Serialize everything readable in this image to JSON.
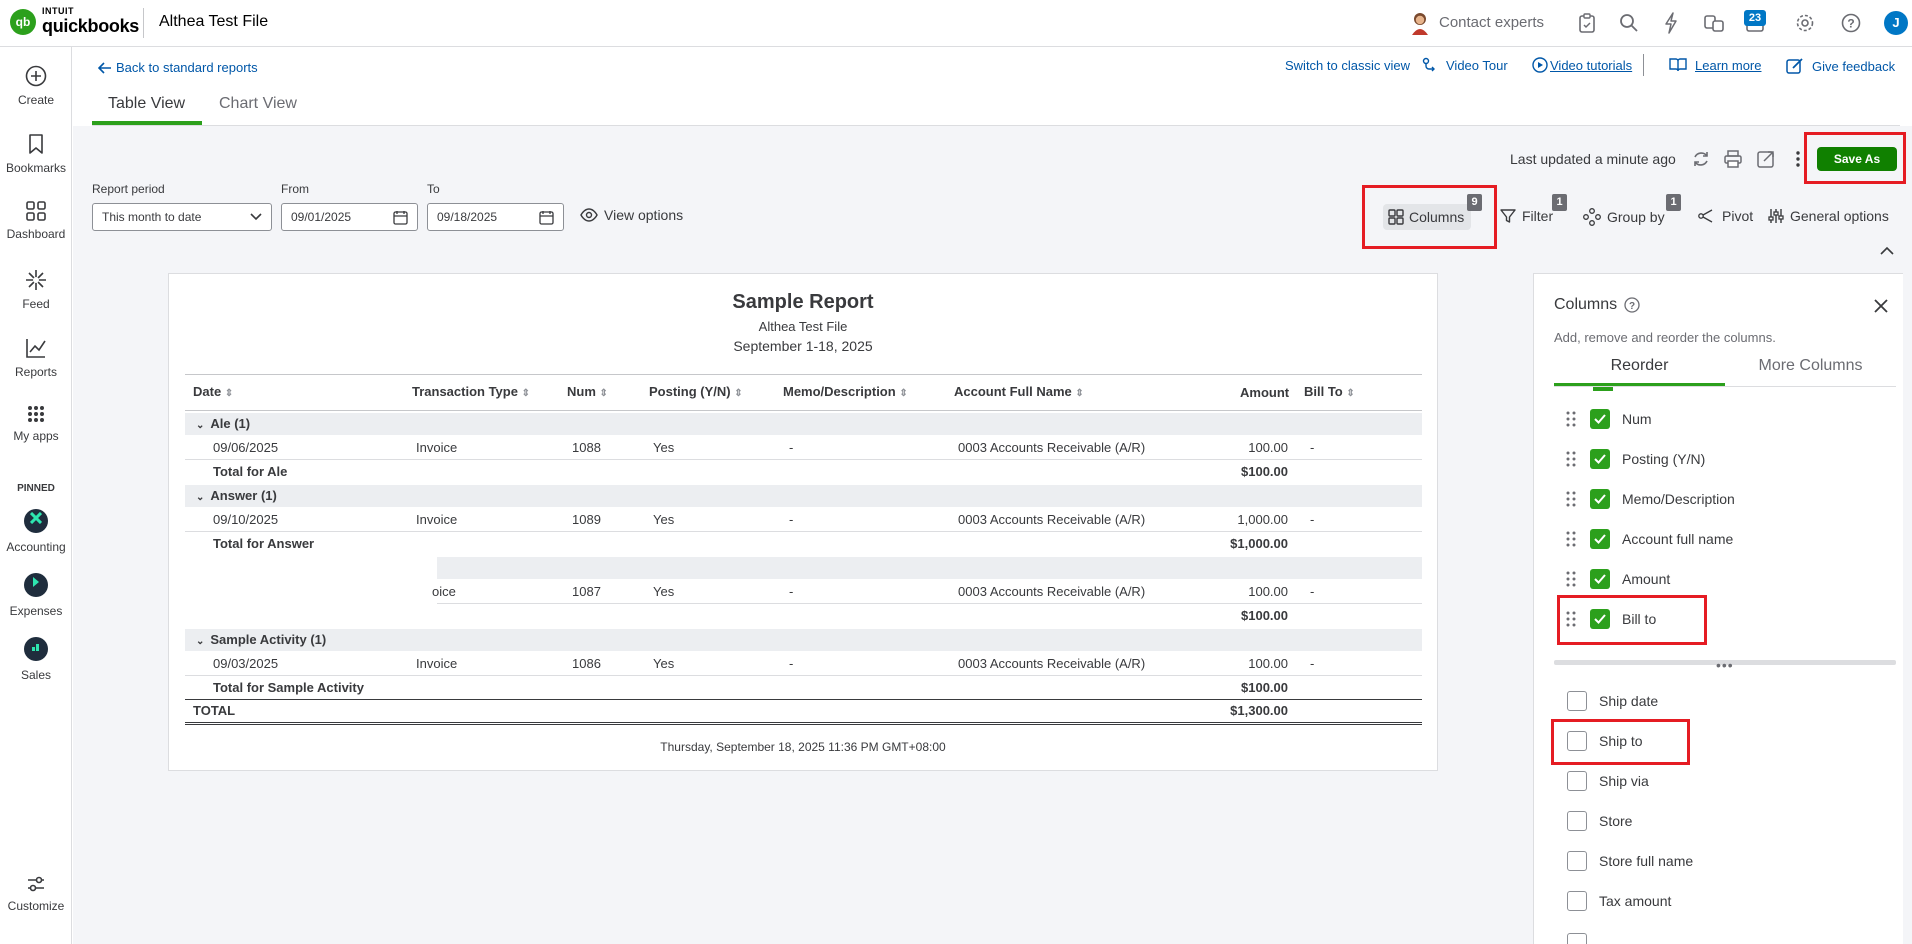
{
  "app": {
    "brand_small": "INTUIT",
    "brand": "quickbooks",
    "company": "Althea Test File"
  },
  "topbar": {
    "contact_experts": "Contact experts",
    "notification_count": "23",
    "avatar_initial": "J"
  },
  "leftnav": {
    "items": [
      {
        "label": "Create"
      },
      {
        "label": "Bookmarks"
      },
      {
        "label": "Dashboard"
      },
      {
        "label": "Feed"
      },
      {
        "label": "Reports"
      },
      {
        "label": "My apps"
      }
    ],
    "pinned_heading": "PINNED",
    "pinned": [
      {
        "label": "Accounting"
      },
      {
        "label": "Expenses"
      },
      {
        "label": "Sales"
      }
    ],
    "customize": "Customize"
  },
  "header": {
    "back_link": "Back to standard reports",
    "switch_classic": "Switch to classic view",
    "video_tour": "Video Tour",
    "video_tutorials": "Video tutorials",
    "learn_more": "Learn more",
    "give_feedback": "Give feedback",
    "tabs": [
      {
        "label": "Table View",
        "active": true
      },
      {
        "label": "Chart View",
        "active": false
      }
    ]
  },
  "toolbar": {
    "last_updated": "Last updated a minute ago",
    "save_as": "Save As",
    "report_period_label": "Report period",
    "report_period_value": "This month to date",
    "from_label": "From",
    "from_value": "09/01/2025",
    "to_label": "To",
    "to_value": "09/18/2025",
    "view_options": "View options",
    "columns": "Columns",
    "columns_badge": "9",
    "filter": "Filter",
    "filter_badge": "1",
    "group_by": "Group by",
    "group_by_badge": "1",
    "pivot": "Pivot",
    "general_options": "General options"
  },
  "report": {
    "title": "Sample Report",
    "company": "Althea Test File",
    "period": "September 1-18, 2025",
    "columns": [
      "Date",
      "Transaction Type",
      "Num",
      "Posting (Y/N)",
      "Memo/Description",
      "Account Full Name",
      "Amount",
      "Bill To"
    ],
    "groups": [
      {
        "name": "Ale (1)",
        "rows": [
          [
            "09/06/2025",
            "Invoice",
            "1088",
            "Yes",
            "-",
            "0003 Accounts Receivable (A/R)",
            "100.00",
            "-"
          ]
        ],
        "total_label": "Total for Ale",
        "total": "$100.00"
      },
      {
        "name": "Answer (1)",
        "rows": [
          [
            "09/10/2025",
            "Invoice",
            "1089",
            "Yes",
            "-",
            "0003 Accounts Receivable (A/R)",
            "1,000.00",
            "-"
          ]
        ],
        "total_label": "Total for Answer",
        "total": "$1,000.00"
      },
      {
        "name": "",
        "rows": [
          [
            "",
            "oice",
            "1087",
            "Yes",
            "-",
            "0003 Accounts Receivable (A/R)",
            "100.00",
            "-"
          ]
        ],
        "total_label": "",
        "total": "$100.00"
      },
      {
        "name": "Sample Activity (1)",
        "rows": [
          [
            "09/03/2025",
            "Invoice",
            "1086",
            "Yes",
            "-",
            "0003 Accounts Receivable (A/R)",
            "100.00",
            "-"
          ]
        ],
        "total_label": "Total for Sample Activity",
        "total": "$100.00"
      }
    ],
    "grand_total_label": "TOTAL",
    "grand_total": "$1,300.00",
    "footer": "Thursday, September 18, 2025 11:36 PM GMT+08:00"
  },
  "columns_panel": {
    "title": "Columns",
    "subtitle": "Add, remove and reorder the columns.",
    "tabs": [
      {
        "label": "Reorder",
        "active": true
      },
      {
        "label": "More Columns",
        "active": false
      }
    ],
    "selected": [
      "Num",
      "Posting (Y/N)",
      "Memo/Description",
      "Account full name",
      "Amount",
      "Bill to"
    ],
    "unselected": [
      "Ship date",
      "Ship to",
      "Ship via",
      "Store",
      "Store full name",
      "Tax amount"
    ]
  },
  "colors": {
    "green": "#2ca01c",
    "save_green": "#108000",
    "highlight_red": "#e51c23",
    "link_blue": "#0057a8"
  }
}
